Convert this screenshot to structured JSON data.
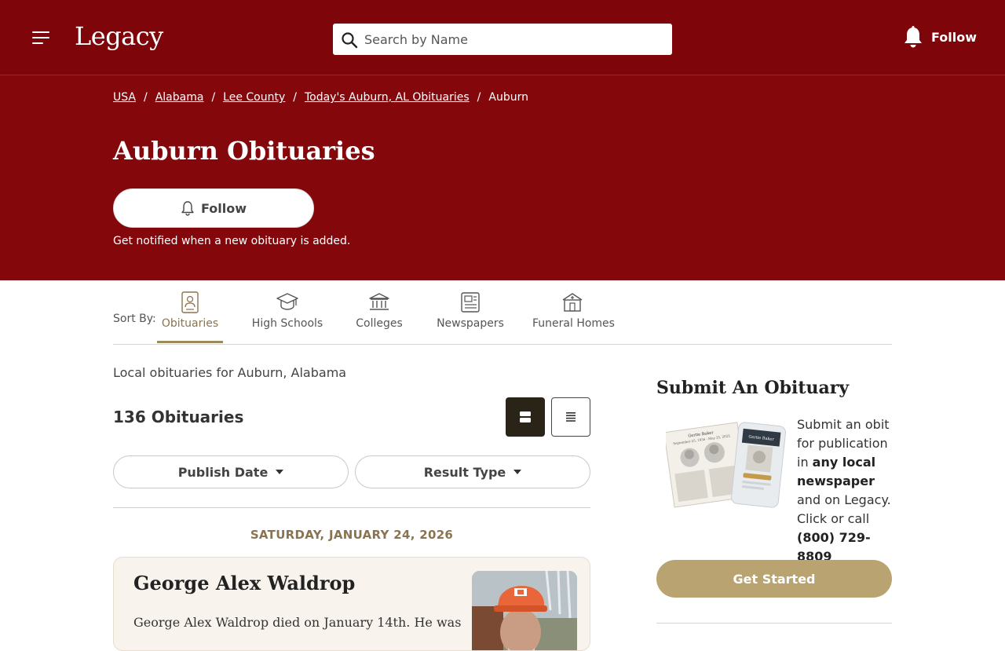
{
  "header": {
    "logo": "Legacy",
    "search_placeholder": "Search by Name",
    "follow_label": "Follow"
  },
  "breadcrumb": [
    "USA",
    "Alabama",
    "Lee County",
    "Today's Auburn, AL Obituaries",
    "Auburn"
  ],
  "hero": {
    "title": "Auburn Obituaries",
    "follow_label": "Follow",
    "note": "Get notified when a new obituary is added."
  },
  "sort": {
    "label": "Sort By:",
    "tabs": [
      "Obituaries",
      "High Schools",
      "Colleges",
      "Newspapers",
      "Funeral Homes"
    ],
    "active": "Obituaries"
  },
  "main": {
    "description": "Local obituaries for Auburn, Alabama",
    "count": "136 Obituaries",
    "filters": [
      "Publish Date",
      "Result Type"
    ],
    "date_heading": "SATURDAY, JANUARY 24, 2026",
    "obituary": {
      "name": "George Alex Waldrop",
      "snippet": "George Alex Waldrop died on January 14th. He was"
    }
  },
  "sidebar": {
    "title": "Submit An Obituary",
    "text_1": "Submit an obit for publication in ",
    "text_bold_1": "any local newspaper",
    "text_2": " and on Legacy. Click or call ",
    "text_bold_2": "(800) 729-8809",
    "illustration_name": "Gertie Baker",
    "illustration_dates": "September 25, 1936 - May 25, 2022",
    "button": "Get Started"
  },
  "colors": {
    "brand_red": "#7e0509",
    "hero_red": "#84070c",
    "gold": "#b9a370",
    "active_tab": "#8a7450"
  }
}
